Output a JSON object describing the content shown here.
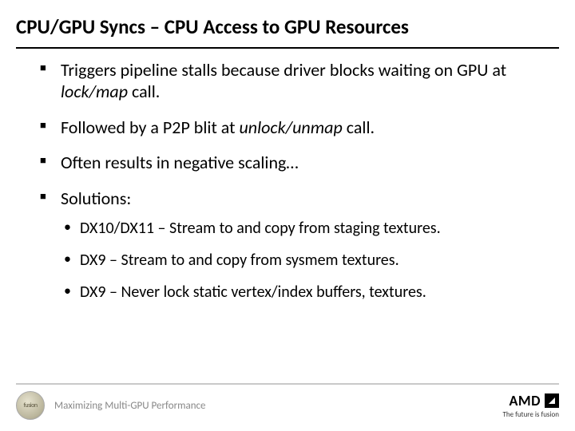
{
  "title": "CPU/GPU Syncs – CPU Access to GPU Resources",
  "bullets": {
    "b1a": "Triggers pipeline stalls because driver blocks waiting on GPU at ",
    "b1em": "lock/map",
    "b1b": " call.",
    "b2a": "Followed by a P2P blit at ",
    "b2em": "unlock/unmap",
    "b2b": " call.",
    "b3": "Often results in negative scaling…",
    "b4": "Solutions:"
  },
  "subs": {
    "s1": "DX10/DX11 – Stream to and copy from staging textures.",
    "s2": "DX9 – Stream to and copy from sysmem textures.",
    "s3": "DX9 – Never lock static vertex/index buffers, textures."
  },
  "footer": {
    "badge": "fusion",
    "text": "Maximizing Multi-GPU Performance",
    "brand": "AMD",
    "tagline": "The future is fusion"
  }
}
